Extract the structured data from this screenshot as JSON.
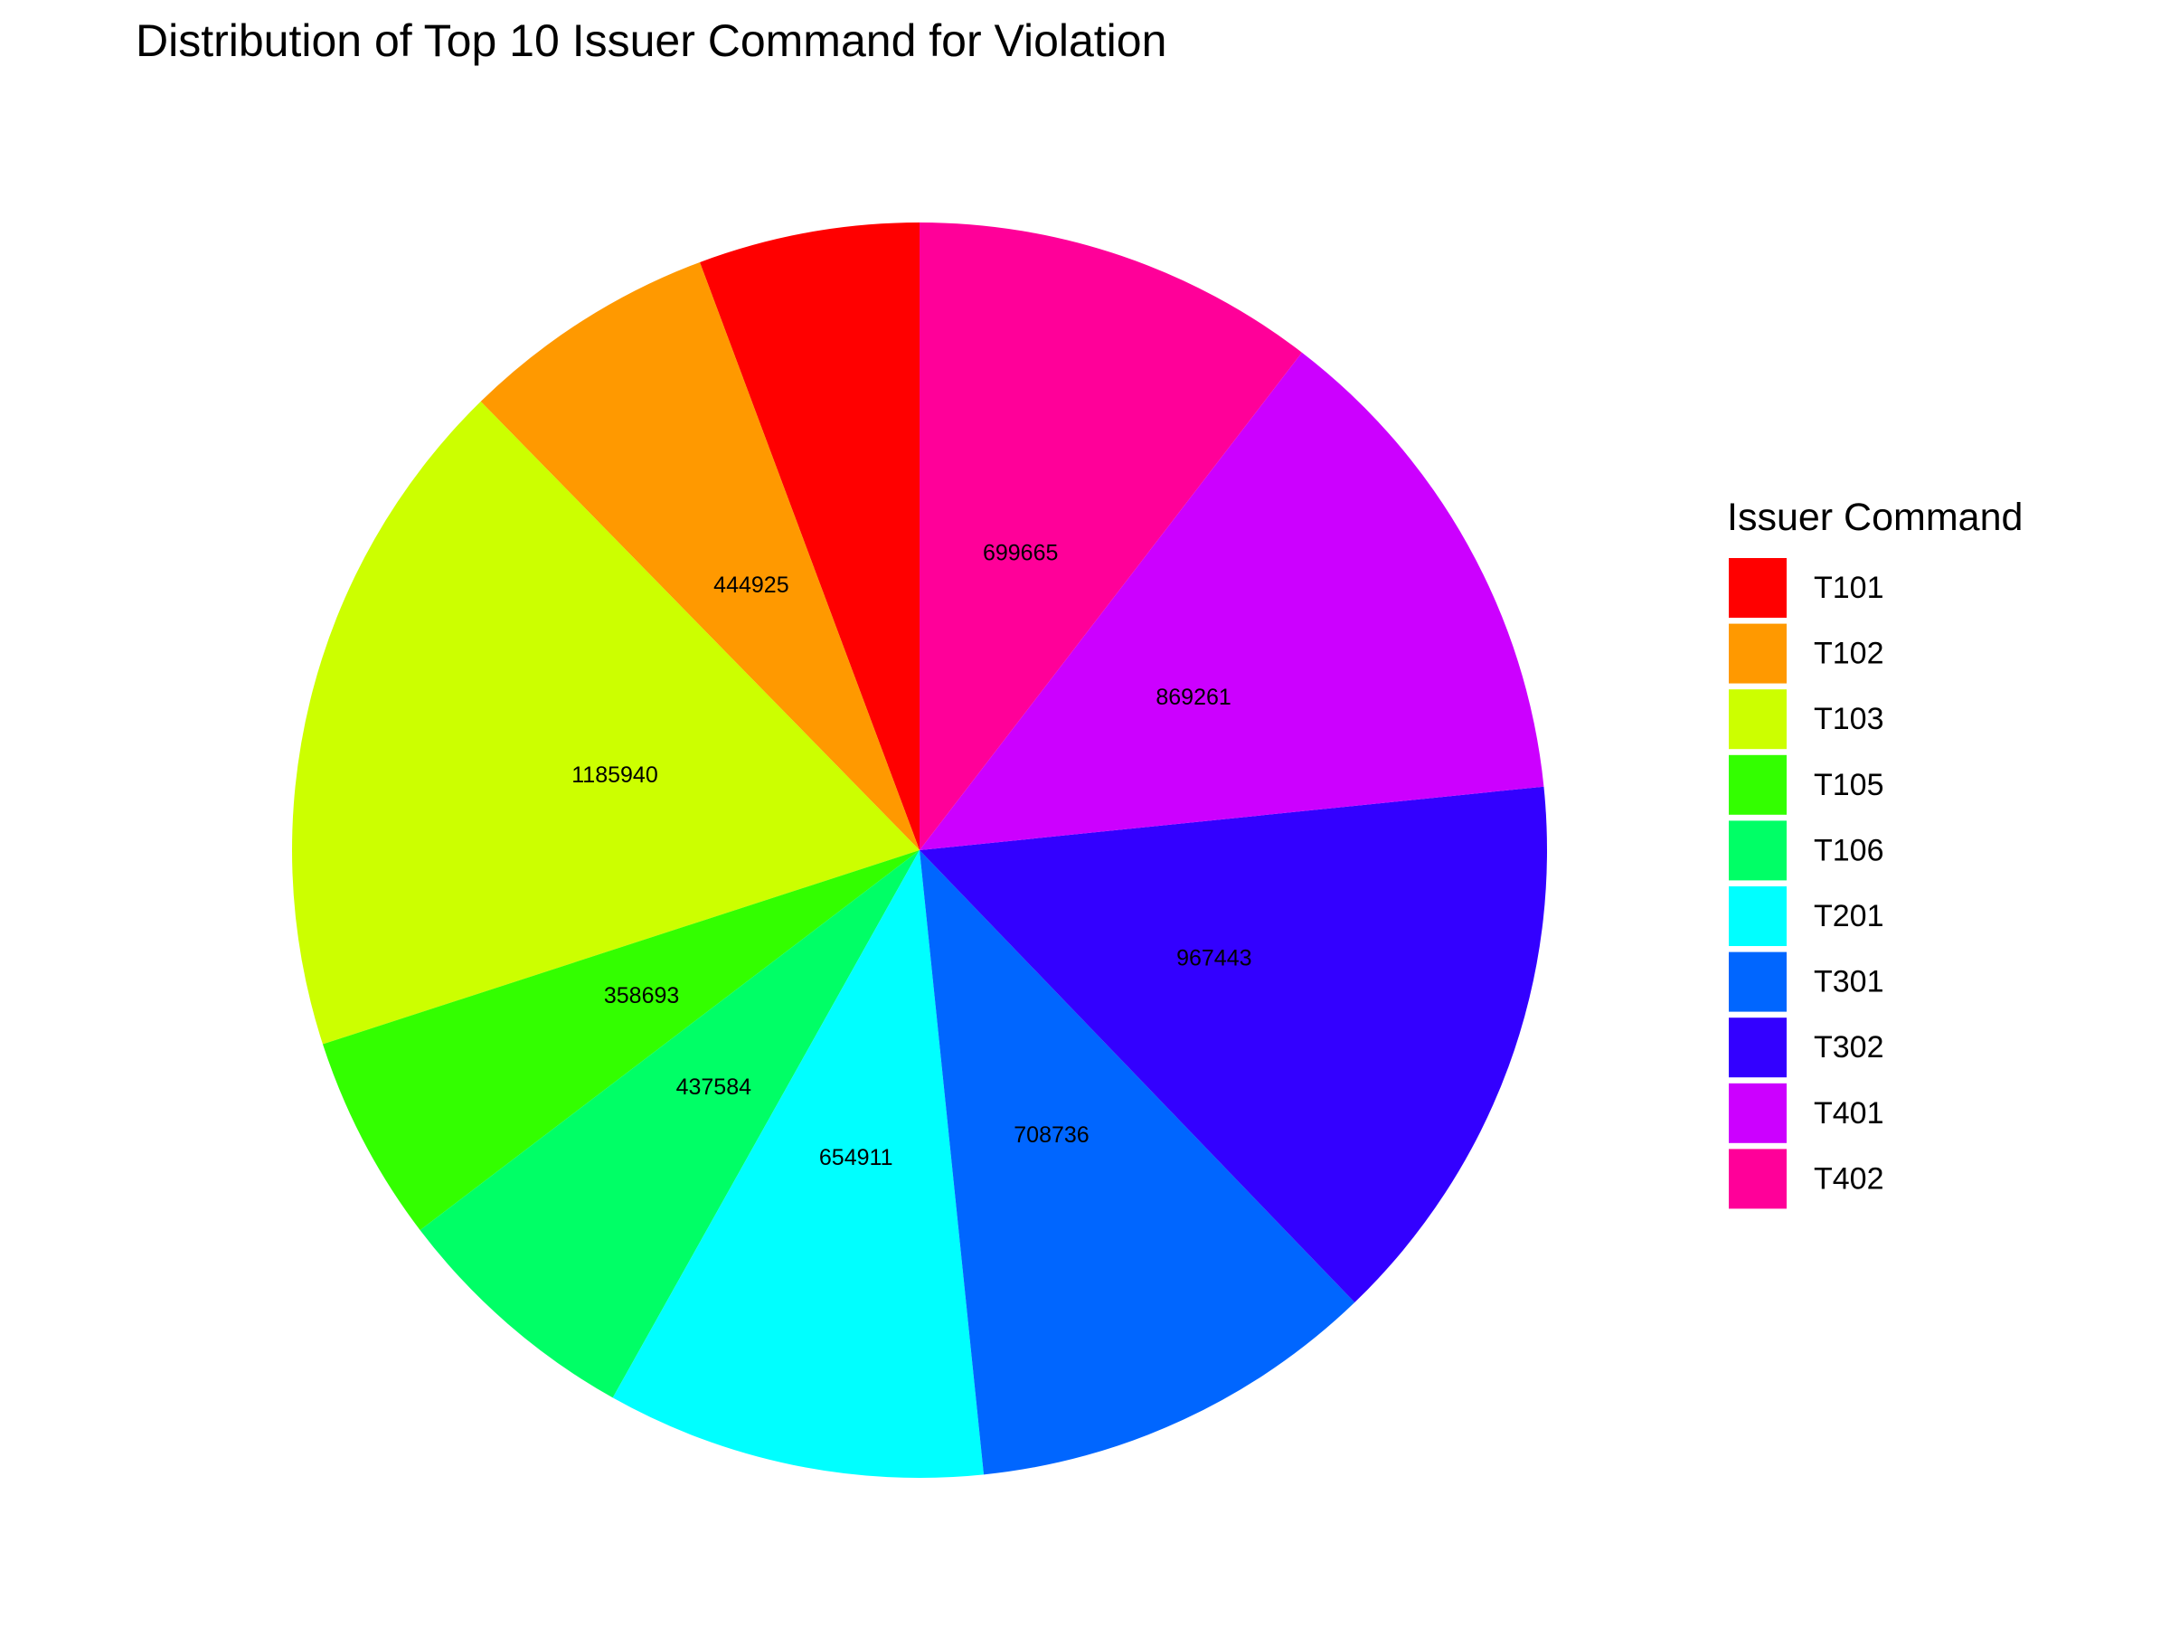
{
  "chart_data": {
    "type": "pie",
    "title": "Distribution of Top 10 Issuer Command for Violation",
    "legend_title": "Issuer Command",
    "legend_position": "right",
    "start": "top",
    "direction": "counterclockwise",
    "slices": [
      {
        "label": "T101",
        "value": 382000,
        "color": "#FF0000",
        "label_text": ""
      },
      {
        "label": "T102",
        "value": 444925,
        "color": "#FF9900",
        "label_text": "444925"
      },
      {
        "label": "T103",
        "value": 1185940,
        "color": "#CCFF00",
        "label_text": "1185940"
      },
      {
        "label": "T105",
        "value": 358693,
        "color": "#33FF00",
        "label_text": "358693"
      },
      {
        "label": "T106",
        "value": 437584,
        "color": "#00FF66",
        "label_text": "437584"
      },
      {
        "label": "T201",
        "value": 654911,
        "color": "#00FFFF",
        "label_text": "654911"
      },
      {
        "label": "T301",
        "value": 708736,
        "color": "#0066FF",
        "label_text": "708736"
      },
      {
        "label": "T302",
        "value": 967443,
        "color": "#3300FF",
        "label_text": "967443"
      },
      {
        "label": "T401",
        "value": 869261,
        "color": "#CC00FF",
        "label_text": "869261"
      },
      {
        "label": "T402",
        "value": 699665,
        "color": "#FF0099",
        "label_text": "699665"
      }
    ]
  }
}
